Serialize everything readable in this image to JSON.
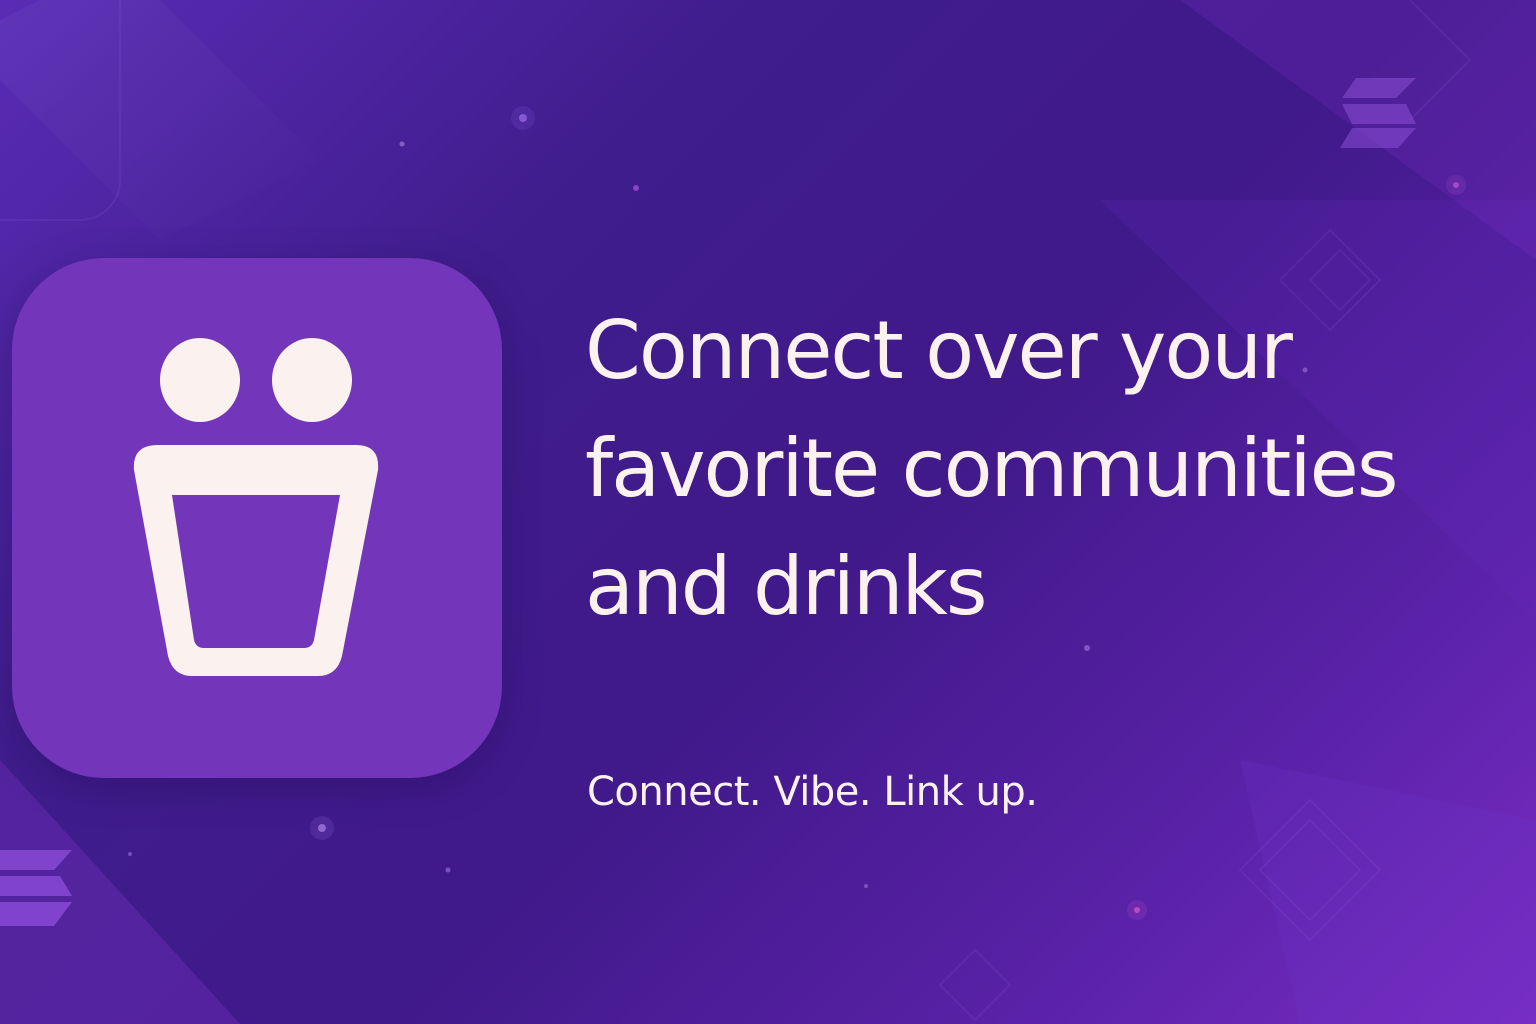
{
  "headline": "Connect over your favorite communities and drinks",
  "tagline": "Connect. Vibe. Link up.",
  "icons": {
    "app_logo": "people-drink-cup-icon",
    "decor_top_right": "striped-diamond-icon",
    "decor_bottom_left": "striped-diamond-icon"
  },
  "colors": {
    "background_start": "#5a2bb5",
    "background_mid": "#40198a",
    "background_end": "#7a2cc4",
    "app_icon_bg": "#7335b9",
    "foreground": "#fbf1ef"
  }
}
